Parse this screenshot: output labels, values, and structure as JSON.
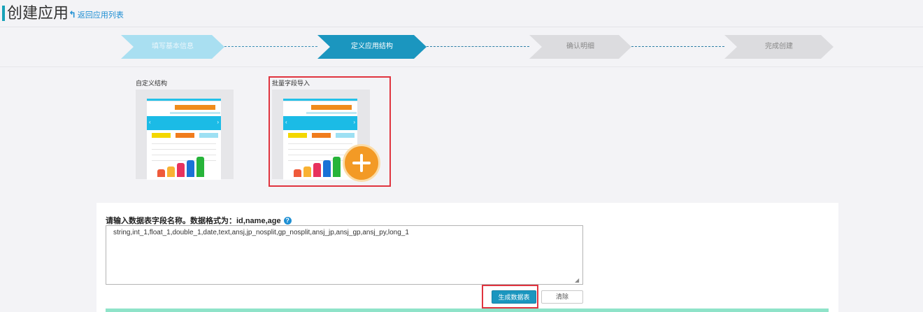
{
  "header": {
    "title": "创建应用",
    "back_link": "返回应用列表"
  },
  "steps": [
    {
      "label": "填写基本信息",
      "state": "done",
      "color": "#a9dff1"
    },
    {
      "label": "定义应用结构",
      "state": "active",
      "color": "#1b96bf"
    },
    {
      "label": "确认明细",
      "state": "pending",
      "color": "#dcdcdf"
    },
    {
      "label": "完成创建",
      "state": "pending",
      "color": "#dcdcdf"
    }
  ],
  "templates": [
    {
      "name": "自定义结构",
      "icon": "dashboard-template-icon",
      "selected": false
    },
    {
      "name": "批量字段导入",
      "icon": "dashboard-template-icon",
      "badge": "plus-icon",
      "selected": true
    }
  ],
  "form": {
    "prompt": "请输入数据表字段名称。数据格式为：id,name,age",
    "help_icon": "question-icon",
    "fields_value": "string,int_1,float_1,double_1,date,text,ansj,jp_nosplit,gp_nosplit,ansj_jp,ansj_gp,ansj_py,long_1",
    "generate_button": "生成数据表",
    "clear_button": "清除"
  },
  "colors": {
    "accent": "#17a2b8",
    "primary_button": "#1b96bf",
    "highlight_border": "#e0343f",
    "badge": "#f39a25"
  }
}
